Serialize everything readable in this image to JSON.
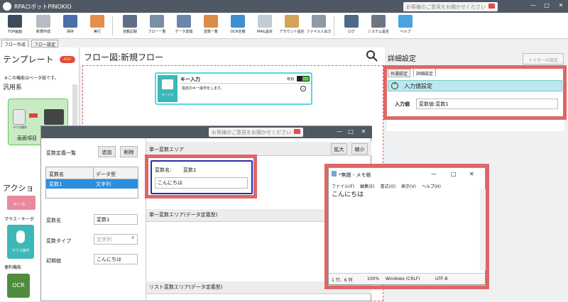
{
  "app": {
    "title": "RPAロボットPINOKIO",
    "feedback": "お客様のご意見をお聞かせください",
    "win_min": "—",
    "win_max": "□",
    "win_close": "✕"
  },
  "ribbon": [
    {
      "label": "TOP画面",
      "icon": "home-icon",
      "color": "#3c4b5a"
    },
    {
      "label": "新規作成",
      "icon": "new-file-icon",
      "color": "#b5bcc3"
    },
    {
      "label": "保存",
      "icon": "save-icon",
      "color": "#4a6ea9"
    },
    {
      "label": "実行",
      "icon": "play-icon",
      "color": "#e58f4a"
    },
    {
      "label": "自動記録",
      "icon": "record-icon",
      "color": "#5f6f86"
    },
    {
      "label": "フロー一覧",
      "icon": "flow-list-icon",
      "color": "#7b8ea3"
    },
    {
      "label": "データ変換",
      "icon": "data-convert-icon",
      "color": "#6b86a8"
    },
    {
      "label": "変数一覧",
      "icon": "variable-list-icon",
      "color": "#d98c47"
    },
    {
      "label": "OCR定義",
      "icon": "ocr-def-icon",
      "color": "#3e8fcf"
    },
    {
      "label": "MAIL設定",
      "icon": "mail-icon",
      "color": "#c3cbd3"
    },
    {
      "label": "アカウント設定",
      "icon": "account-icon",
      "color": "#d4a25a"
    },
    {
      "label": "ファイル入出力",
      "icon": "file-io-icon",
      "color": "#8d9aa7"
    },
    {
      "label": "ログ",
      "icon": "log-icon",
      "color": "#4f6a86"
    },
    {
      "label": "システム設定",
      "icon": "gear-icon",
      "color": "#6e7781"
    },
    {
      "label": "ヘルプ",
      "icon": "help-icon",
      "color": "#4aa3e0"
    }
  ],
  "tabs": {
    "flow_create": "フロー作成",
    "flow_settings": "フロー設定"
  },
  "left": {
    "template": "テンプレート",
    "new_badge": "NEW!",
    "beta_note": "※この機能はベータ版です。",
    "category": "汎用系",
    "card_title": "画面項目",
    "mouse_label": "マウス操作",
    "key_label": "キー入力",
    "action": "アクショ",
    "mail": "メール",
    "mouse_kb": "マウス・キーボ",
    "mouse_op": "マウス操作",
    "convenience": "便利機能",
    "ocr": "OCR"
  },
  "flow": {
    "title": "フロー図:新規フロー",
    "node_title": "キー入力",
    "node_status": "有効",
    "node_desc": "指定のキー操作をします。",
    "node_icon_label": "キー入力"
  },
  "right": {
    "title": "詳細設定",
    "trigger": "トリガーの設定",
    "tab_common": "共通設定",
    "tab_detail": "詳細設定",
    "section": "入力値設定",
    "input_label": "入力値",
    "input_value": "変数値:変数1"
  },
  "dlg": {
    "feedback": "お客様のご意見をお聞かせください",
    "var_list": "変数定義一覧",
    "add": "追加",
    "delete": "削除",
    "col_name": "変数名",
    "col_type": "データ型",
    "row_name": "変数1",
    "row_type": "文字列",
    "name_label": "変数名",
    "name_value": "変数1",
    "type_label": "変数タイプ",
    "type_value": "文字列",
    "init_label": "初期値",
    "init_value": "こんにちは",
    "single_area": "単一変数エリア",
    "expand": "拡大",
    "shrink": "縮小",
    "var_name_label": "変数名:",
    "var_name_value": "変数1",
    "var_value": "こんにちは",
    "single_def_area": "単一変数エリア(データ定義型)",
    "list_area": "リスト変数エリア(データ定義型)"
  },
  "notepad": {
    "title": "*無題 - メモ帳",
    "menu": [
      "ファイル(F)",
      "編集(E)",
      "書式(O)",
      "表示(V)",
      "ヘルプ(H)"
    ],
    "content": "こんにちは",
    "status": [
      "1 行、6 列",
      "100%",
      "Windows (CRLF)",
      "UTF-8"
    ]
  }
}
